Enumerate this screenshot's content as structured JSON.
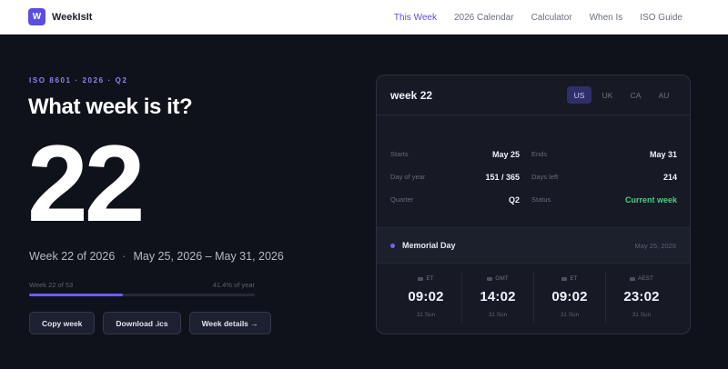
{
  "brand": {
    "logo_letter": "W",
    "name": "WeekIsIt"
  },
  "nav": [
    {
      "label": "This Week",
      "active": true
    },
    {
      "label": "2026 Calendar",
      "active": false
    },
    {
      "label": "Calculator",
      "active": false
    },
    {
      "label": "When Is",
      "active": false
    },
    {
      "label": "ISO Guide",
      "active": false
    }
  ],
  "hero": {
    "eyebrow": "ISO 8601 · 2026 · Q2",
    "title": "What week is it?",
    "week_number": "22",
    "subtitle_week": "Week 22 of 2026",
    "subtitle_sep": "·",
    "subtitle_range": "May 25, 2026 – May 31, 2026",
    "progress_left": "Week 22 of 53",
    "progress_right": "41.4% of year",
    "progress_fraction": 0.414
  },
  "buttons": {
    "copy": "Copy week",
    "download": "Download .ics",
    "details": "Week details →"
  },
  "card": {
    "title": "week 22",
    "tabs": [
      {
        "label": "US",
        "active": true
      },
      {
        "label": "UK",
        "active": false
      },
      {
        "label": "CA",
        "active": false
      },
      {
        "label": "AU",
        "active": false
      }
    ],
    "stats": [
      {
        "label": "Starts",
        "value": "May 25"
      },
      {
        "label": "Ends",
        "value": "May 31"
      },
      {
        "label": "Day of year",
        "value": "151 / 365"
      },
      {
        "label": "Days left",
        "value": "214"
      },
      {
        "label": "Quarter",
        "value": "Q2"
      },
      {
        "label": "Status",
        "value": "Current week"
      }
    ],
    "holiday": {
      "name": "Memorial Day",
      "date": "May 25, 2026"
    },
    "zones": [
      {
        "label": "ET",
        "time": "09:02",
        "day": "31 Sun"
      },
      {
        "label": "GMT",
        "time": "14:02",
        "day": "31 Sun"
      },
      {
        "label": "ET",
        "time": "09:02",
        "day": "31 Sun"
      },
      {
        "label": "AEST",
        "time": "23:02",
        "day": "31 Sun"
      }
    ]
  },
  "colors": {
    "accent": "#5a4ee0",
    "status_green": "#44d07d",
    "background": "#10121b"
  }
}
